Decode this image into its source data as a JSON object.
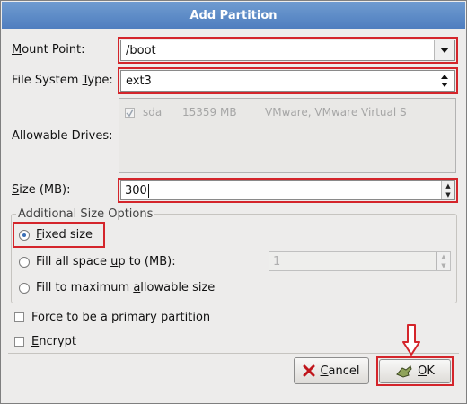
{
  "dialog": {
    "title": "Add Partition"
  },
  "mount_point": {
    "label_pre": "",
    "label_ul": "M",
    "label_post": "ount Point:",
    "value": "/boot"
  },
  "fs_type": {
    "label_pre": "File System ",
    "label_ul": "T",
    "label_post": "ype:",
    "value": "ext3"
  },
  "drives": {
    "label": "Allowable Drives:",
    "items": [
      {
        "checked": true,
        "name": "sda",
        "size": "15359 MB",
        "model": "VMware, VMware Virtual S"
      }
    ]
  },
  "size": {
    "label_pre": "",
    "label_ul": "S",
    "label_post": "ize (MB):",
    "value": "300"
  },
  "size_options": {
    "title": "Additional Size Options",
    "fixed": {
      "label_pre": "",
      "label_ul": "F",
      "label_post": "ixed size",
      "selected": true
    },
    "fill_up_to": {
      "label_pre": "Fill all space ",
      "label_ul": "u",
      "label_post": "p to (MB):",
      "value": "1"
    },
    "fill_max": {
      "label_pre": "Fill to maximum ",
      "label_ul": "a",
      "label_post": "llowable size"
    }
  },
  "primary": {
    "label": "Force to be a primary partition",
    "checked": false
  },
  "encrypt": {
    "label_pre": "",
    "label_ul": "E",
    "label_post": "ncrypt",
    "checked": false
  },
  "buttons": {
    "cancel": {
      "label_pre": "",
      "label_ul": "C",
      "label_post": "ancel",
      "icon": "cancel-x-icon"
    },
    "ok": {
      "label_pre": "",
      "label_ul": "O",
      "label_post": "K",
      "icon": "ok-hand-icon"
    }
  },
  "colors": {
    "highlight": "#d4252b",
    "title_bar": "#5a88c4"
  }
}
